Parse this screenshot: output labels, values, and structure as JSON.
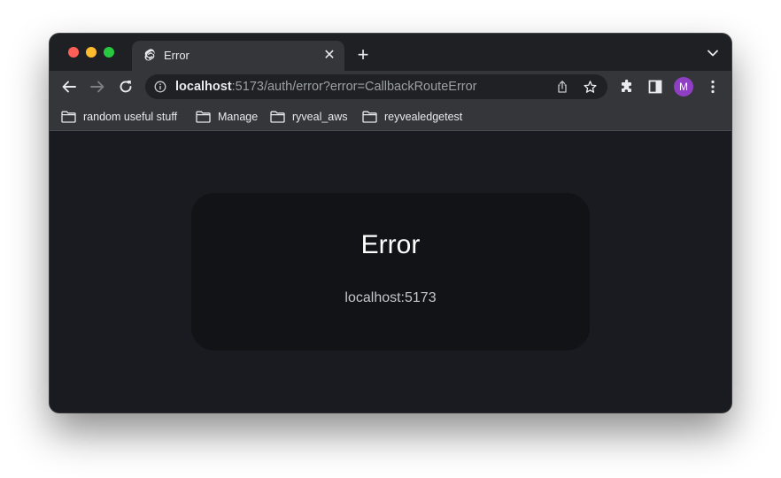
{
  "browser": {
    "tab": {
      "title": "Error",
      "favicon": "svelte-icon"
    },
    "new_tab_label": "+",
    "close_tab_label": "✕",
    "address": {
      "host": "localhost",
      "rest": ":5173/auth/error?error=CallbackRouteError"
    },
    "profile_initial": "M",
    "accent_profile": "#8e3fc3"
  },
  "bookmarks": [
    {
      "label": "random useful stuff",
      "icon": "folder-icon"
    },
    {
      "label": "Manage",
      "icon": "folder-icon"
    },
    {
      "label": "ryveal_aws",
      "icon": "folder-icon"
    },
    {
      "label": "reyvealedgetest",
      "icon": "folder-icon"
    }
  ],
  "page": {
    "title": "Error",
    "host": "localhost:5173"
  }
}
